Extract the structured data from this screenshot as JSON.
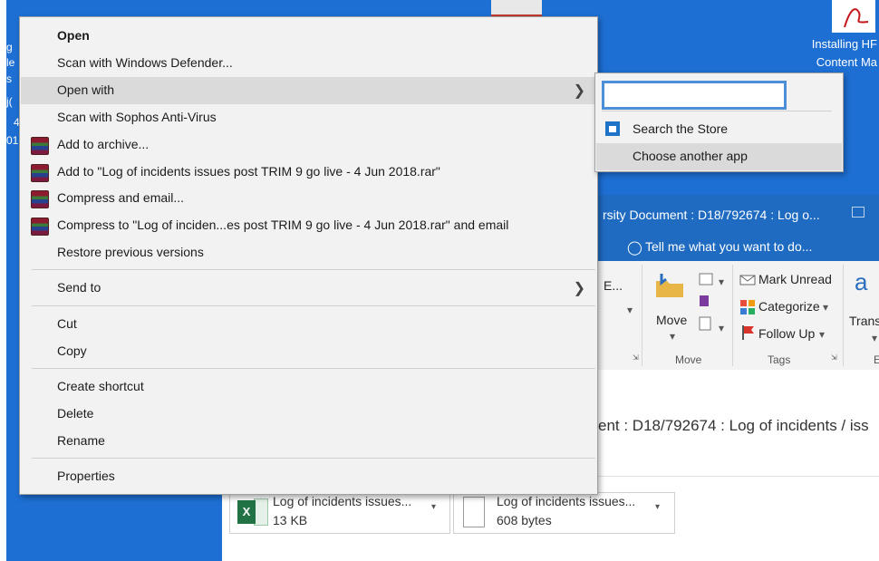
{
  "desktop": {
    "left_text": [
      "g",
      "le",
      "s",
      "j(",
      "4",
      "01"
    ],
    "caption_line1": "Installing HF",
    "caption_line2": "Content Ma"
  },
  "outlook": {
    "title": "rsity Document : D18/792674 : Log o...",
    "tell_me": "Tell me what you want to do...",
    "ribbon": {
      "partial_left": "E...",
      "move_label": "Move",
      "move_group": "Move",
      "mark_unread": "Mark Unread",
      "categorize": "Categorize",
      "follow_up": "Follow Up",
      "tags_group": "Tags",
      "translate": "Trans",
      "translate_group": "E"
    },
    "subject": "ent : D18/792674 : Log of incidents / iss",
    "attachments": [
      {
        "name": "Log of incidents  issues...",
        "size": "13 KB"
      },
      {
        "name": "Log of incidents  issues...",
        "size": "608 bytes"
      }
    ]
  },
  "context_menu": {
    "open": "Open",
    "scan_defender": "Scan with Windows Defender...",
    "open_with": "Open with",
    "scan_sophos": "Scan with Sophos Anti-Virus",
    "add_archive": "Add to archive...",
    "add_rar": "Add to \"Log of incidents  issues post TRIM 9 go live - 4 Jun 2018.rar\"",
    "compress_email": "Compress and email...",
    "compress_rar_email": "Compress to \"Log of inciden...es post TRIM 9 go live - 4 Jun 2018.rar\" and email",
    "restore": "Restore previous versions",
    "send_to": "Send to",
    "cut": "Cut",
    "copy": "Copy",
    "create_shortcut": "Create shortcut",
    "delete": "Delete",
    "rename": "Rename",
    "properties": "Properties"
  },
  "submenu": {
    "input_value": "",
    "search_store": "Search the Store",
    "choose_app": "Choose another app"
  },
  "colors": {
    "desktop_blue": "#1d6fd3",
    "outlook_blue": "#1f6bc2",
    "menu_bg": "#f2f2f2",
    "highlight": "#dadada",
    "focus_border": "#4a8fd8"
  }
}
